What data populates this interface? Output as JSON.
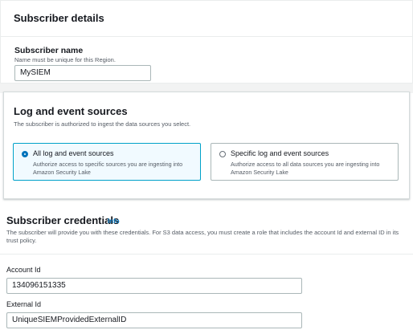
{
  "subscriber_details": {
    "heading": "Subscriber details",
    "name_label": "Subscriber name",
    "name_hint": "Name must be unique for this Region.",
    "name_value": "MySIEM"
  },
  "sources": {
    "heading": "Log and event sources",
    "description": "The subscriber is authorized to ingest the data sources you select.",
    "options": [
      {
        "title": "All log and event sources",
        "desc": "Authorize access to specific sources you are ingesting into Amazon Security Lake",
        "selected": true
      },
      {
        "title": "Specific log and event sources",
        "desc": "Authorize access to all data sources you are ingesting into Amazon Security Lake",
        "selected": false
      }
    ]
  },
  "credentials": {
    "heading": "Subscriber credentials",
    "info": "Info",
    "description": "The subscriber will provide you with these credentials. For S3 data access, you must create a role that includes the account Id and external ID in its trust policy.",
    "account_label": "Account Id",
    "account_value": "134096151335",
    "external_label": "External Id",
    "external_value": "UniqueSIEMProvidedExternalID"
  },
  "colors": {
    "accent": "#0073bb",
    "selected_border": "#00a1c9",
    "selected_bg": "#f1faff"
  }
}
